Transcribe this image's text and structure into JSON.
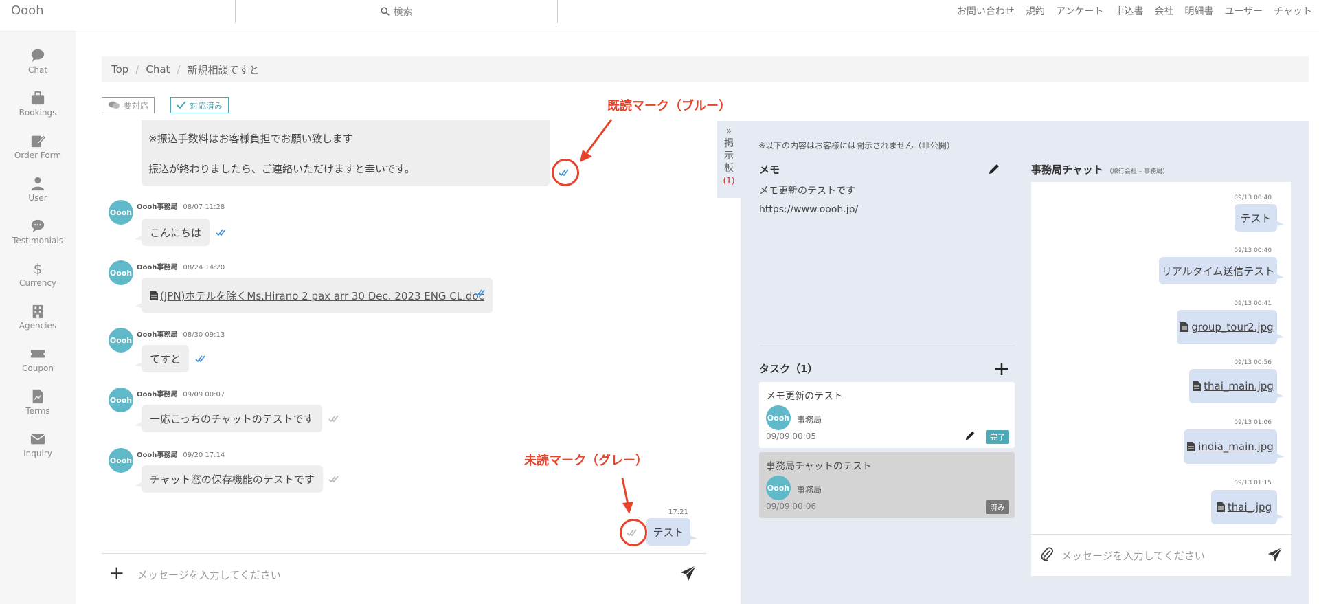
{
  "header": {
    "brand": "Oooh",
    "search_placeholder": "検索",
    "nav": [
      "お問い合わせ",
      "規約",
      "アンケート",
      "申込書",
      "会社",
      "明細書",
      "ユーザー",
      "チャット"
    ]
  },
  "sidebar": {
    "items": [
      {
        "label": "Chat",
        "icon": "chat-icon"
      },
      {
        "label": "Bookings",
        "icon": "briefcase-icon"
      },
      {
        "label": "Order Form",
        "icon": "edit-form-icon"
      },
      {
        "label": "User",
        "icon": "user-icon"
      },
      {
        "label": "Testimonials",
        "icon": "comment-icon"
      },
      {
        "label": "Currency",
        "icon": "dollar-icon"
      },
      {
        "label": "Agencies",
        "icon": "building-icon"
      },
      {
        "label": "Coupon",
        "icon": "ticket-icon"
      },
      {
        "label": "Terms",
        "icon": "file-icon"
      },
      {
        "label": "Inquiry",
        "icon": "envelope-icon"
      }
    ]
  },
  "breadcrumb": [
    "Top",
    "Chat",
    "新規相談てすと"
  ],
  "filters": {
    "pending": "要対応",
    "done": "対応済み"
  },
  "chat": {
    "first_lines": [
      "※振込手数料はお客様負担でお願い致します",
      "振込が終わりましたら、ご連絡いただけますと幸いです。"
    ],
    "messages": [
      {
        "avatar": "Oooh",
        "sender": "Oooh事務局",
        "time": "08/07 11:28",
        "text": "こんにちは",
        "status": "read"
      },
      {
        "avatar": "Oooh",
        "sender": "Oooh事務局",
        "time": "08/24 14:20",
        "text": "(JPN)ホテルを除くMs.Hirano 2 pax arr 30 Dec. 2023 ENG CL.doc",
        "status": "read"
      },
      {
        "avatar": "Oooh",
        "sender": "Oooh事務局",
        "time": "08/30 09:13",
        "text": "てすと",
        "status": "read"
      },
      {
        "avatar": "Oooh",
        "sender": "Oooh事務局",
        "time": "09/09 00:07",
        "text": "一応こっちのチャットのテストです",
        "status": "unread"
      },
      {
        "avatar": "Oooh",
        "sender": "Oooh事務局",
        "time": "09/20 17:14",
        "text": "チャット窓の保存機能のテストです",
        "status": "unread"
      }
    ],
    "own_message": {
      "time": "17:21",
      "text": "テスト"
    },
    "input_placeholder": "メッセージを入力してください"
  },
  "annotations": {
    "read": "既読マーク（ブルー）",
    "unread": "未読マーク（グレー）"
  },
  "board": {
    "tab_label": [
      "掲",
      "示",
      "板"
    ],
    "tab_count": "(1)",
    "notice": "※以下の内容はお客様には開示されません（非公開）",
    "memo_title": "メモ",
    "memo_lines": [
      "メモ更新のテストです",
      "https://www.oooh.jp/"
    ],
    "task_title": "タスク（1）",
    "tasks": [
      {
        "title": "メモ更新のテスト",
        "avatar": "Oooh",
        "assignee": "事務局",
        "date": "09/09 00:05",
        "badge": "完了"
      },
      {
        "title": "事務局チャットのテスト",
        "avatar": "Oooh",
        "assignee": "事務局",
        "date": "09/09 00:06",
        "badge": "済み"
      }
    ]
  },
  "office_chat": {
    "title": "事務局チャット",
    "subtitle": "（旅行会社 – 事務局）",
    "messages": [
      {
        "time": "09/13 00:40",
        "text": "テスト",
        "file": false
      },
      {
        "time": "09/13 00:40",
        "text": "リアルタイム送信テスト",
        "file": false
      },
      {
        "time": "09/13 00:41",
        "text": "group_tour2.jpg",
        "file": true
      },
      {
        "time": "09/13 00:56",
        "text": "thai_main.jpg",
        "file": true
      },
      {
        "time": "09/13 01:06",
        "text": "india_main.jpg",
        "file": true
      },
      {
        "time": "09/13 01:15",
        "text": "thai_.jpg",
        "file": true
      }
    ],
    "input_placeholder": "メッセージを入力してください"
  },
  "colors": {
    "accent": "#5fb9c9",
    "read_check": "#3b8fd6",
    "annotation": "#e8432b",
    "badge_done": "#4da8b8",
    "badge_finished": "#777777"
  }
}
